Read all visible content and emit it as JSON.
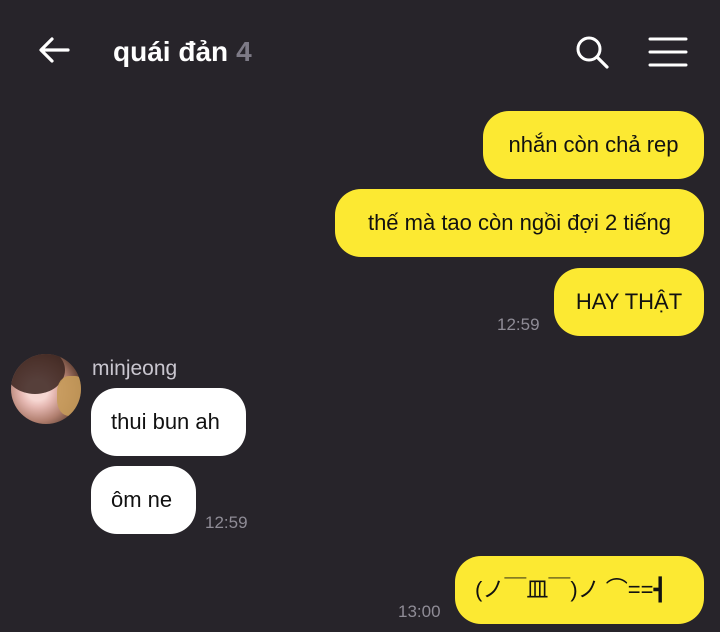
{
  "header": {
    "title": "quái đản",
    "member_count": "4",
    "back_icon": "arrow-left-icon",
    "search_icon": "search-icon",
    "menu_icon": "hamburger-menu-icon"
  },
  "colors": {
    "background": "#27242a",
    "my_bubble": "#fce932",
    "their_bubble": "#ffffff",
    "timestamp": "#8f8c96"
  },
  "messages": [
    {
      "from": "me",
      "text": "nhắn còn chả rep"
    },
    {
      "from": "me",
      "text": "thế mà tao còn ngồi đợi 2 tiếng"
    },
    {
      "from": "me",
      "text": "HAY THẬT",
      "time": "12:59"
    },
    {
      "from": "minjeong",
      "sender_name": "minjeong",
      "text": "thui bun ah"
    },
    {
      "from": "minjeong",
      "text": "ôm ne",
      "time": "12:59"
    },
    {
      "from": "me",
      "text": "(ノ￣皿￣)ノ ⌒==┫",
      "time": "13:00"
    }
  ]
}
